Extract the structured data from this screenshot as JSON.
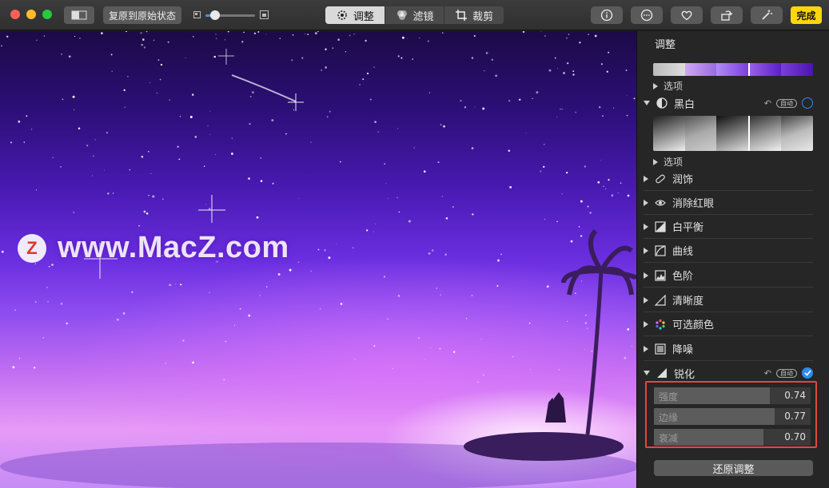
{
  "toolbar": {
    "revert_label": "复原到原始状态",
    "zoom_percent": 20,
    "tabs": [
      {
        "label": "调整",
        "icon": "adjust-dial-icon",
        "active": true
      },
      {
        "label": "滤镜",
        "icon": "filters-icon",
        "active": false
      },
      {
        "label": "裁剪",
        "icon": "crop-icon",
        "active": false
      }
    ],
    "right_buttons": [
      "info-icon",
      "more-icon",
      "heart-icon",
      "rotate-icon",
      "magic-wand-icon"
    ],
    "done_label": "完成",
    "accent": "#ffd60a"
  },
  "photo": {
    "watermark": "www.MacZ.com",
    "watermark_logo": "Z"
  },
  "sidebar": {
    "title": "调整",
    "light_options_label": "选项",
    "bw": {
      "label": "黑白",
      "auto": "自动",
      "options_label": "选项"
    },
    "sections": [
      {
        "label": "润饰",
        "icon": "bandage-icon"
      },
      {
        "label": "消除红眼",
        "icon": "eye-icon"
      },
      {
        "label": "白平衡",
        "icon": "white-balance-icon"
      },
      {
        "label": "曲线",
        "icon": "curves-icon"
      },
      {
        "label": "色阶",
        "icon": "levels-icon"
      },
      {
        "label": "清晰度",
        "icon": "definition-icon"
      },
      {
        "label": "可选颜色",
        "icon": "selective-color-icon"
      },
      {
        "label": "降噪",
        "icon": "noise-reduction-icon"
      }
    ],
    "sharpen": {
      "label": "锐化",
      "auto": "自动",
      "sliders": [
        {
          "label": "强度",
          "value": "0.74",
          "fraction": 0.74
        },
        {
          "label": "边缘",
          "value": "0.77",
          "fraction": 0.77
        },
        {
          "label": "衰减",
          "value": "0.70",
          "fraction": 0.7
        }
      ]
    },
    "reset_label": "还原调整"
  }
}
